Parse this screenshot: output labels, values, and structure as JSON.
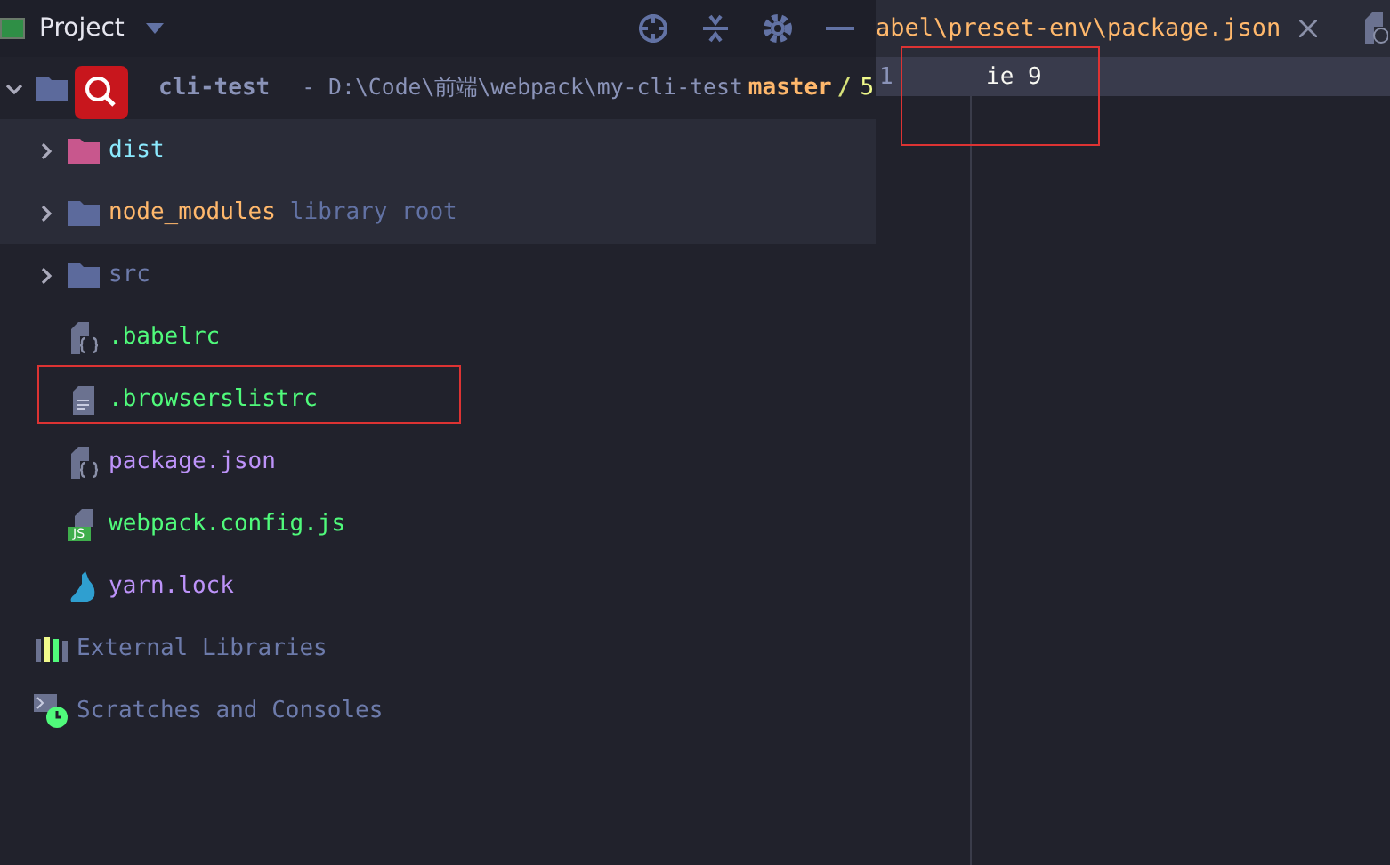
{
  "project_panel": {
    "title": "Project",
    "tree": [
      {
        "name": "cli-test",
        "kind": "folder",
        "expanded": true,
        "selected": false,
        "color": "#8a93b8",
        "excluded": false,
        "path": "- D:\\Code\\前端\\webpack\\my-cli-test",
        "branch": "master",
        "branch_sep": "/",
        "branch_extra": "5",
        "children": [
          {
            "name": "dist",
            "kind": "folder",
            "expanded": false,
            "selected": true,
            "color": "#8be9fd",
            "excluded": true
          },
          {
            "name": "node_modules",
            "kind": "folder",
            "expanded": false,
            "selected": true,
            "color": "#ffb86c",
            "excluded": false,
            "suffix": "library root"
          },
          {
            "name": "src",
            "kind": "folder",
            "expanded": false,
            "selected": false,
            "color": "#6d7bab",
            "excluded": false
          },
          {
            "name": ".babelrc",
            "kind": "config",
            "selected": false,
            "color": "#50fa7b"
          },
          {
            "name": ".browserslistrc",
            "kind": "text",
            "selected": false,
            "color": "#50fa7b"
          },
          {
            "name": "package.json",
            "kind": "config",
            "selected": false,
            "color": "#bd93f9"
          },
          {
            "name": "webpack.config.js",
            "kind": "js",
            "selected": false,
            "color": "#50fa7b",
            "badge": "JS"
          },
          {
            "name": "yarn.lock",
            "kind": "yarn",
            "selected": false,
            "color": "#bd93f9"
          }
        ]
      },
      {
        "name": "External Libraries",
        "kind": "libraries",
        "selected": false,
        "color": "#6d7bab"
      },
      {
        "name": "Scratches and Consoles",
        "kind": "scratches",
        "selected": false,
        "color": "#6d7bab"
      }
    ]
  },
  "editor": {
    "tab": {
      "label": "abel\\preset-env\\package.json"
    },
    "lines": [
      {
        "number": "1",
        "text": "ie 9"
      }
    ]
  }
}
